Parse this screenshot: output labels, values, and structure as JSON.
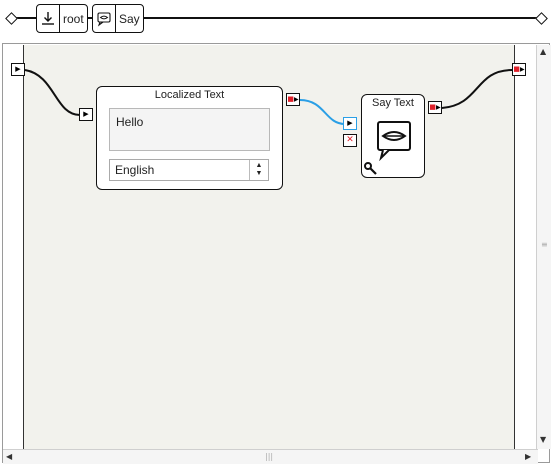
{
  "breadcrumb": {
    "items": [
      {
        "label": "root",
        "icon": "root-download-icon"
      },
      {
        "label": "Say",
        "icon": "speech-bubble-icon"
      }
    ]
  },
  "nodes": {
    "localized_text": {
      "title": "Localized Text",
      "text_value": "Hello",
      "language": "English"
    },
    "say_text": {
      "title": "Say Text",
      "icon": "speech-bubble-lips-icon",
      "params_icon": "wrench-icon"
    }
  },
  "colors": {
    "canvas": "#f2f2ed",
    "link_active": "#2a9fe6",
    "port_start": "#111111",
    "port_stop": "#e0202a"
  }
}
